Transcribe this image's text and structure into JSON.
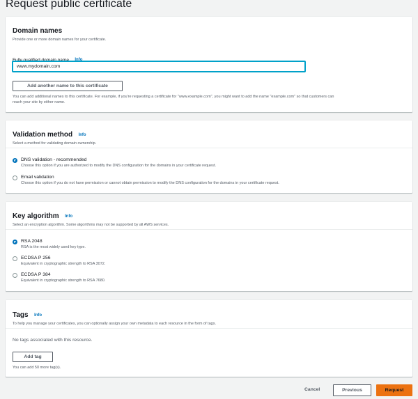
{
  "page": {
    "title": "Request public certificate"
  },
  "domain_names": {
    "title": "Domain names",
    "description": "Provide one or more domain names for your certificate.",
    "field_label": "Fully qualified domain name",
    "info": "Info",
    "input_value": "www.mydomain.com",
    "add_button": "Add another name to this certificate",
    "help_line1": "You can add additional names to this certificate. For example, if you're requesting a certificate for \"www.example.com\", you might want to add the name \"example.com\" so that customers can",
    "help_line2": "reach your site by either name."
  },
  "validation": {
    "title": "Validation method",
    "info": "Info",
    "description": "Select a method for validating domain ownership.",
    "options": [
      {
        "label": "DNS validation - recommended",
        "desc": "Choose this option if you are authorized to modify the DNS configuration for the domains in your certificate request.",
        "selected": true
      },
      {
        "label": "Email validation",
        "desc": "Choose this option if you do not have permission or cannot obtain permission to modify the DNS configuration for the domains in your certificate request.",
        "selected": false
      }
    ]
  },
  "key_algorithm": {
    "title": "Key algorithm",
    "info": "Info",
    "description": "Select an encryption algorithm. Some algorithms may not be supported by all AWS services.",
    "options": [
      {
        "label": "RSA 2048",
        "desc": "RSA is the most widely used key type.",
        "selected": true
      },
      {
        "label": "ECDSA P 256",
        "desc": "Equivalent in cryptographic strength to RSA 3072.",
        "selected": false
      },
      {
        "label": "ECDSA P 384",
        "desc": "Equivalent in cryptographic strength to RSA 7680.",
        "selected": false
      }
    ]
  },
  "tags": {
    "title": "Tags",
    "info": "Info",
    "description": "To help you manage your certificates, you can optionally assign your own metadata to each resource in the form of tags.",
    "empty_text": "No tags associated with this resource.",
    "add_button": "Add tag",
    "limit_text": "You can add 50 more tag(s)."
  },
  "footer": {
    "cancel": "Cancel",
    "previous": "Previous",
    "request": "Request"
  },
  "colors": {
    "accent": "#0073bb",
    "primary_button": "#ec7211",
    "input_focus": "#00a1c9"
  }
}
